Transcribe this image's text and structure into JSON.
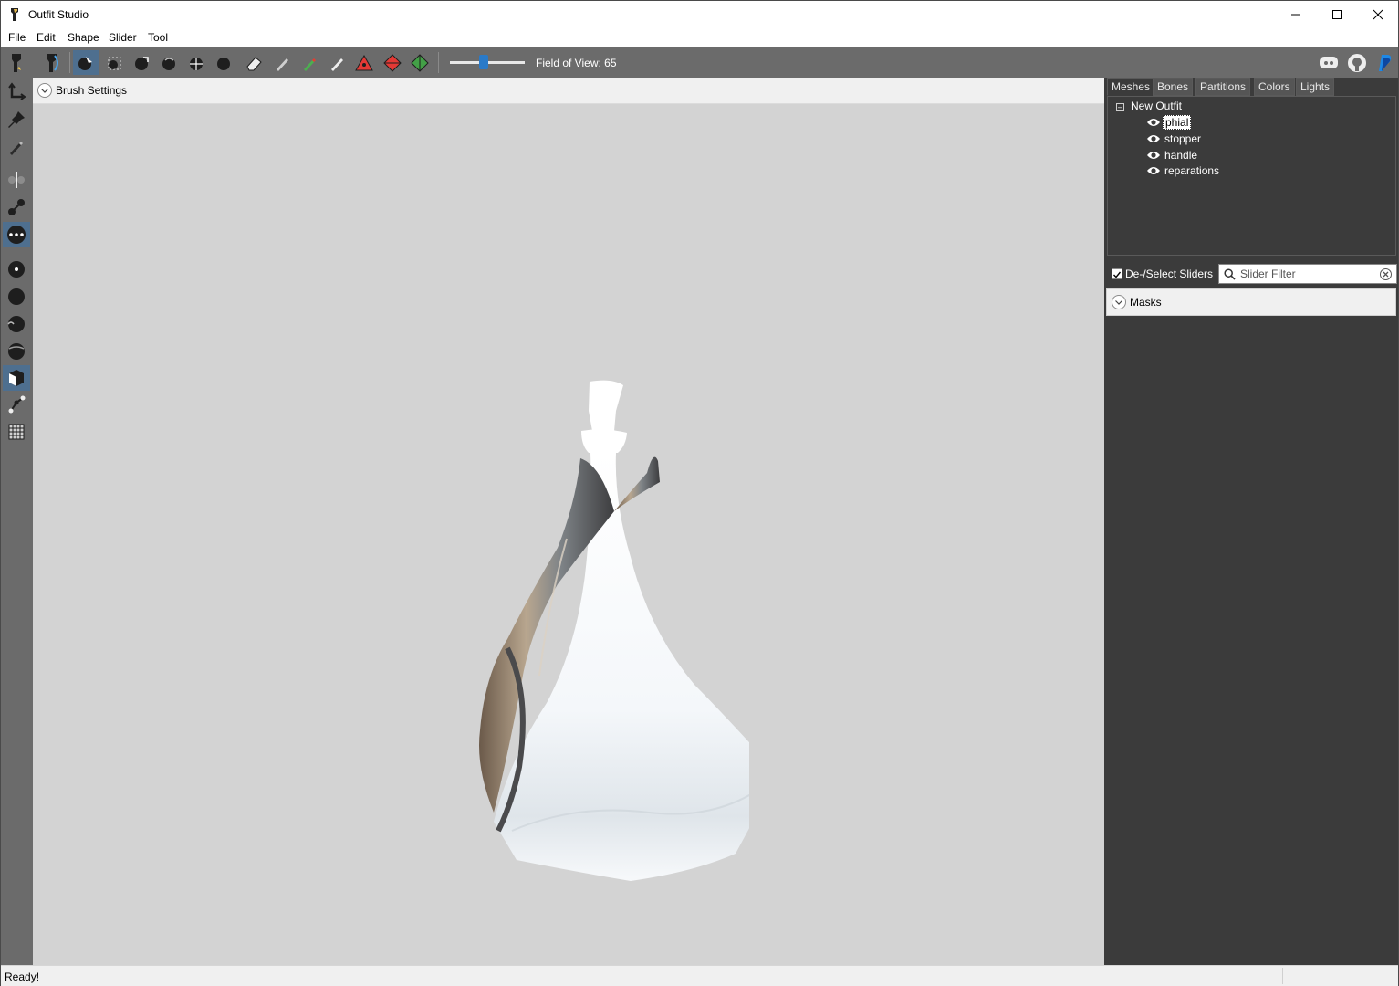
{
  "window": {
    "title": "Outfit Studio"
  },
  "menu": [
    "File",
    "Edit",
    "Shape",
    "Slider",
    "Tool"
  ],
  "toolbar": {
    "fov_label": "Field of View: 65",
    "fov_value": 65,
    "fov_slider_fraction": 0.45,
    "accent": "#4e6f8f"
  },
  "viewport": {
    "brush_settings_label": "Brush Settings",
    "background": "#d3d3d3"
  },
  "panel": {
    "tabs": [
      "Meshes",
      "Bones",
      "Partitions",
      "Colors",
      "Lights"
    ],
    "active_tab": "Meshes",
    "tree": {
      "root": "New Outfit",
      "items": [
        {
          "label": "phial",
          "selected": true
        },
        {
          "label": "stopper",
          "selected": false
        },
        {
          "label": "handle",
          "selected": false
        },
        {
          "label": "reparations",
          "selected": false
        }
      ]
    },
    "deselect_label": "De-/Select Sliders",
    "filter_placeholder": "Slider Filter",
    "masks_label": "Masks"
  },
  "status": {
    "text": "Ready!"
  }
}
